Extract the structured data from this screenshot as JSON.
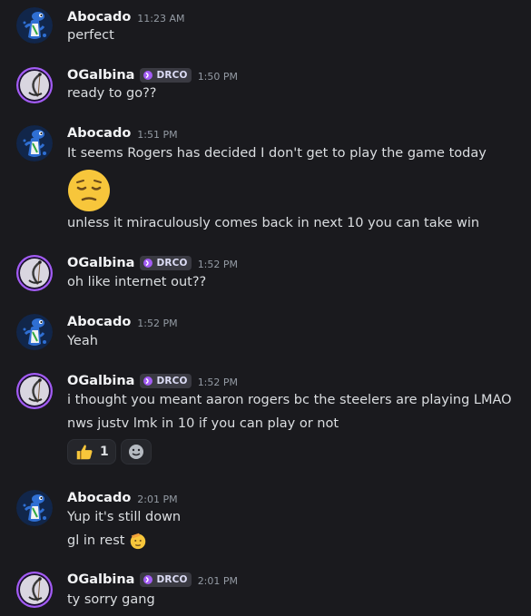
{
  "users": {
    "abocado": {
      "name": "Abocado"
    },
    "ogalbina": {
      "name": "OGalbina",
      "tag": "DRCO"
    }
  },
  "messages": [
    {
      "time": "11:23 AM",
      "lines": [
        "perfect"
      ]
    },
    {
      "time": "1:50 PM",
      "lines": [
        "ready to go??"
      ]
    },
    {
      "time": "1:51 PM",
      "lines": [
        "It seems Rogers has decided I don't get to play the game today",
        "unless it miraculously comes back in next 10 you can take win"
      ],
      "emoji": "pensive-face"
    },
    {
      "time": "1:52 PM",
      "lines": [
        "oh like internet out??"
      ]
    },
    {
      "time": "1:52 PM",
      "lines": [
        "Yeah"
      ]
    },
    {
      "time": "1:52 PM",
      "lines": [
        "i thought you meant aaron rogers bc the steelers are playing LMAO",
        "nws justv lmk in 10 if you can play or not"
      ],
      "reactions": [
        {
          "emoji": "thumbs-up",
          "count": "1"
        }
      ]
    },
    {
      "time": "2:01 PM",
      "lines": [
        "Yup it's still down",
        "gl in rest"
      ],
      "inline_emoji": "saluting-face"
    },
    {
      "time": "2:01 PM",
      "lines": [
        "ty sorry gang"
      ]
    }
  ],
  "colors": {
    "background": "#1a1a1e",
    "text": "#dbdee1",
    "username": "#f2f3f5",
    "timestamp": "#949ba4",
    "tag_bg": "#3a3a42",
    "tag_icon": "#a35cf5",
    "avatar_abocado_bg": "#11264a",
    "avatar_ogalbina_ring": "#a35cf5",
    "emoji_yellow": "#f7c63b"
  }
}
